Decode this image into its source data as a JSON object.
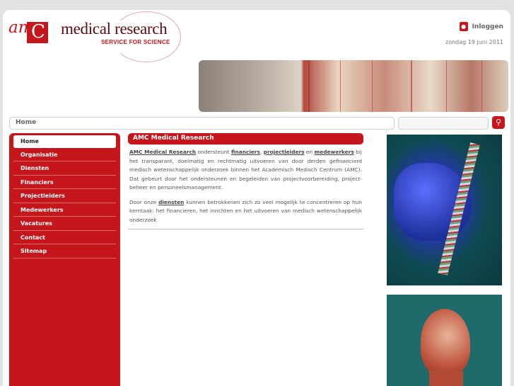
{
  "header": {
    "logo_amc": "am",
    "logo_c": "C",
    "logo_title": "medical research",
    "logo_tagline": "SERVICE FOR SCIENCE",
    "login_label": "Inloggen",
    "date": "zondag 19 juni 2011"
  },
  "breadcrumb": {
    "label": "Home"
  },
  "search": {
    "placeholder": "",
    "button_icon": "search-icon"
  },
  "sidebar": {
    "items": [
      {
        "label": "Home",
        "active": true
      },
      {
        "label": "Organisatie"
      },
      {
        "label": "Diensten"
      },
      {
        "label": "Financiers"
      },
      {
        "label": "Projectleiders"
      },
      {
        "label": "Medewerkers"
      },
      {
        "label": "Vacatures"
      },
      {
        "label": "Contact"
      },
      {
        "label": "Sitemap"
      }
    ]
  },
  "main": {
    "title": "AMC Medical Research",
    "p1": {
      "link_amc": "AMC Medical Research",
      "t1": " ondersteunt ",
      "link_financiers": "financiers",
      "t2": ", ",
      "link_projectleiders": "projectleiders",
      "t3": " en ",
      "link_medewerkers": "medewerkers",
      "t4": " bij het transparant, doelmatig en rechtmatig uitvoeren van door derden gefinancierd medisch wetenschappelijk onderzoek binnen het Academisch Medisch Centrum (AMC). Dat gebeurt door het ondersteunen en begeleiden van projectvoorbereiding, project- beheer en personeelsmanagement."
    },
    "p2": {
      "t1": "Door onze ",
      "link_diensten": "diensten",
      "t2": " kunnen betrokkenen zich zo veel mogelijk te concentreren op hun kerntaak: het financieren, het inrichten en het uitvoeren van medisch wetenschappelijk onderzoek"
    }
  },
  "colors": {
    "brand_red": "#c4161c"
  }
}
